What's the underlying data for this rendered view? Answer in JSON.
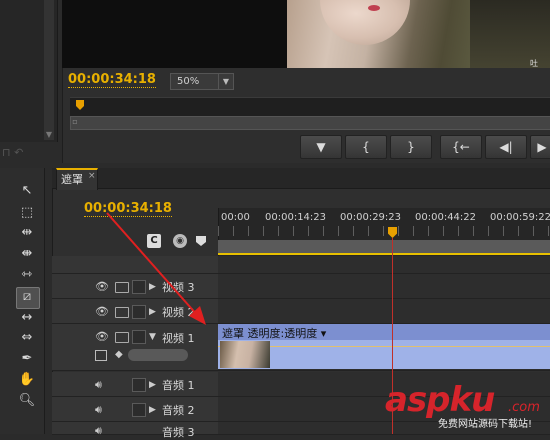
{
  "program_monitor": {
    "timecode": "00:00:34:18",
    "zoom": "50%",
    "transport_buttons": [
      "marker",
      "in-point",
      "out-point",
      "go-to-in",
      "step-back",
      "play"
    ],
    "video_watermark": "吐"
  },
  "timeline": {
    "tab_label": "遮罩",
    "tab_close": "×",
    "timecode": "00:00:34:18",
    "ruler_ticks": [
      "00:00",
      "00:00:14:23",
      "00:00:29:23",
      "00:00:44:22",
      "00:00:59:22"
    ],
    "video_tracks": [
      {
        "label": "视频 3"
      },
      {
        "label": "视频 2"
      },
      {
        "label": "视频 1"
      }
    ],
    "audio_tracks": [
      {
        "label": "音频 1"
      },
      {
        "label": "音频 2"
      },
      {
        "label": "音频 3"
      }
    ],
    "clip": {
      "name": "遮罩",
      "effect": "透明度:透明度"
    }
  },
  "watermark": {
    "main": "aspku",
    "dotcom": ".com",
    "sub": "免费网站源码下载站!"
  },
  "colors": {
    "timecode": "#e8b000",
    "playhead": "#c0302a",
    "clip": "#7c8fd0",
    "annotation": "#e02020"
  }
}
